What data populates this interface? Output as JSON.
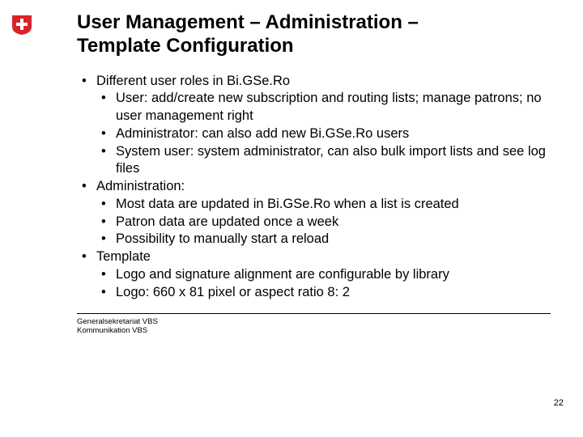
{
  "title_line1": "User Management – Administration –",
  "title_line2": "Template Configuration",
  "bullets": {
    "b1": "Different user roles in Bi.GSe.Ro",
    "b1a": "User: add/create new subscription and routing lists; manage patrons; no user management right",
    "b1b": "Administrator: can also add new Bi.GSe.Ro users",
    "b1c": "System user: system administrator, can also bulk import lists and see log files",
    "b2": "Administration:",
    "b2a": "Most data are updated in Bi.GSe.Ro when a list is created",
    "b2b": "Patron data are updated once a week",
    "b2c": "Possibility to manually start a reload",
    "b3": "Template",
    "b3a": "Logo and signature alignment are configurable by library",
    "b3b": "Logo: 660 x 81 pixel or aspect ratio 8: 2"
  },
  "footer_line1": "Generalsekretariat VBS",
  "footer_line2": "Kommunikation VBS",
  "page_number": "22",
  "logo_color": "#d8232a"
}
